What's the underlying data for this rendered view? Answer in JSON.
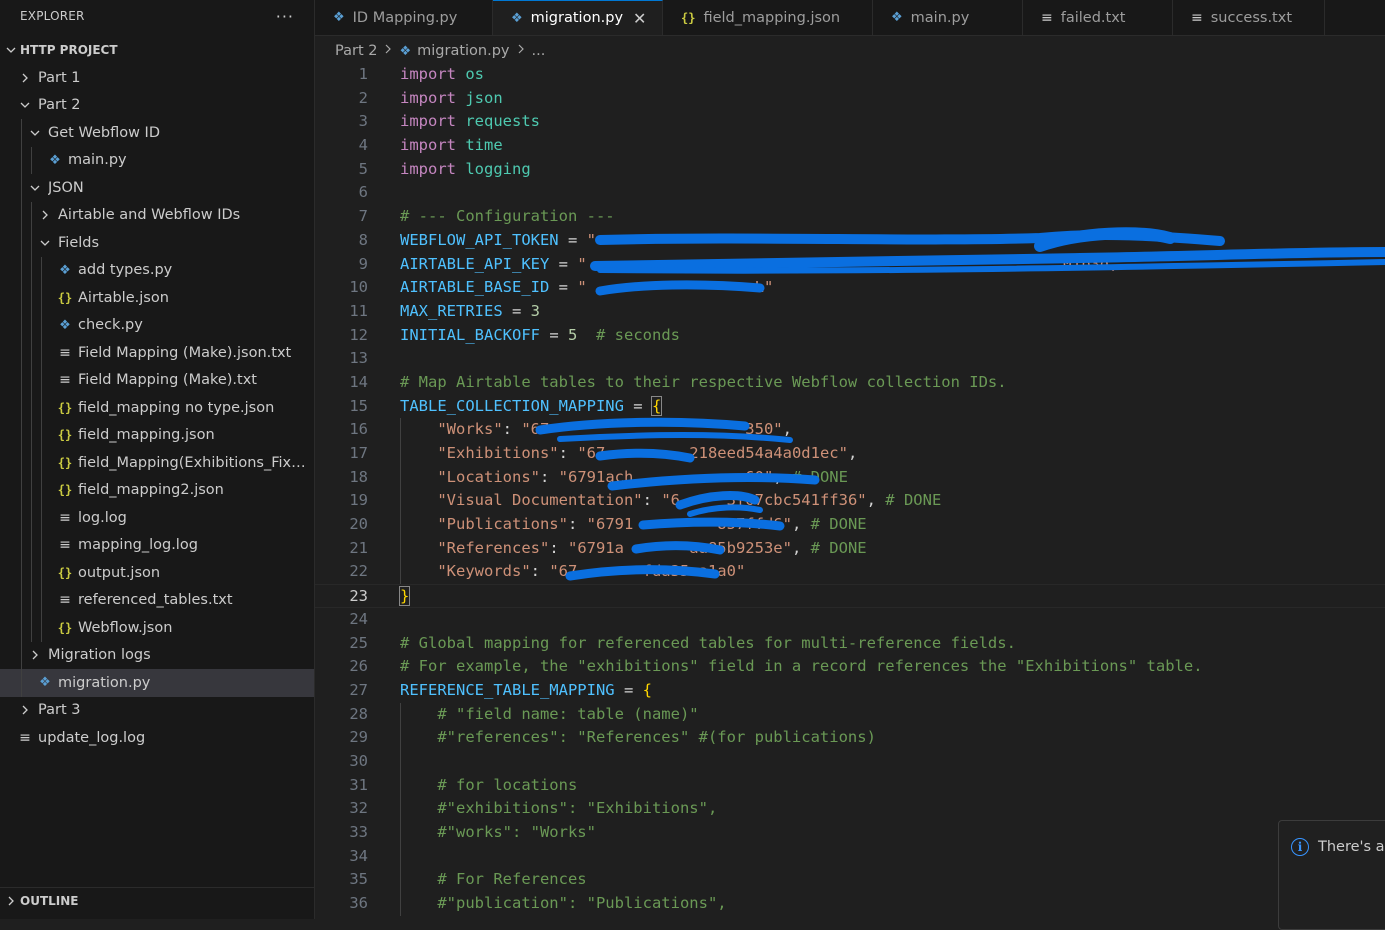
{
  "sidebar": {
    "title": "EXPLORER",
    "more": "···",
    "project": "HTTP PROJECT",
    "outline": "OUTLINE",
    "items": [
      {
        "label": "Part 1",
        "type": "folder",
        "level": 0,
        "open": false
      },
      {
        "label": "Part 2",
        "type": "folder",
        "level": 0,
        "open": true
      },
      {
        "label": "Get Webflow ID",
        "type": "folder",
        "level": 1,
        "open": true
      },
      {
        "label": "main.py",
        "type": "py",
        "level": 2
      },
      {
        "label": "JSON",
        "type": "folder",
        "level": 1,
        "open": true
      },
      {
        "label": "Airtable and Webflow IDs",
        "type": "folder",
        "level": 2,
        "open": false
      },
      {
        "label": "Fields",
        "type": "folder",
        "level": 2,
        "open": true
      },
      {
        "label": "add types.py",
        "type": "py",
        "level": 3
      },
      {
        "label": "Airtable.json",
        "type": "json",
        "level": 3
      },
      {
        "label": "check.py",
        "type": "py",
        "level": 3
      },
      {
        "label": "Field Mapping (Make).json.txt",
        "type": "txt",
        "level": 3
      },
      {
        "label": "Field Mapping (Make).txt",
        "type": "txt",
        "level": 3
      },
      {
        "label": "field_mapping no type.json",
        "type": "json",
        "level": 3
      },
      {
        "label": "field_mapping.json",
        "type": "json",
        "level": 3
      },
      {
        "label": "field_Mapping(Exhibitions_Fix).js...",
        "type": "json",
        "level": 3
      },
      {
        "label": "field_mapping2.json",
        "type": "json",
        "level": 3
      },
      {
        "label": "log.log",
        "type": "txt",
        "level": 3
      },
      {
        "label": "mapping_log.log",
        "type": "txt",
        "level": 3
      },
      {
        "label": "output.json",
        "type": "json",
        "level": 3
      },
      {
        "label": "referenced_tables.txt",
        "type": "txt",
        "level": 3
      },
      {
        "label": "Webflow.json",
        "type": "json",
        "level": 3
      },
      {
        "label": "Migration logs",
        "type": "folder",
        "level": 1,
        "open": false
      },
      {
        "label": "migration.py",
        "type": "py",
        "level": 1,
        "selected": true
      },
      {
        "label": "Part 3",
        "type": "folder",
        "level": 0,
        "open": false
      },
      {
        "label": "update_log.log",
        "type": "txt",
        "level": 0
      }
    ]
  },
  "tabs": [
    {
      "label": "ID Mapping.py",
      "type": "py",
      "width": 178
    },
    {
      "label": "migration.py",
      "type": "py",
      "active": true,
      "close": "✕",
      "width": 170
    },
    {
      "label": "field_mapping.json",
      "type": "json",
      "width": 210
    },
    {
      "label": "main.py",
      "type": "py",
      "width": 150
    },
    {
      "label": "failed.txt",
      "type": "txt",
      "width": 150
    },
    {
      "label": "success.txt",
      "type": "txt",
      "width": 152
    }
  ],
  "breadcrumb": {
    "folder": "Part 2",
    "file": "migration.py",
    "rest": "..."
  },
  "editor": {
    "current_line": 23,
    "lines": [
      [
        [
          "kw",
          "import"
        ],
        [
          "op",
          " "
        ],
        [
          "mod",
          "os"
        ]
      ],
      [
        [
          "kw",
          "import"
        ],
        [
          "op",
          " "
        ],
        [
          "mod",
          "json"
        ]
      ],
      [
        [
          "kw",
          "import"
        ],
        [
          "op",
          " "
        ],
        [
          "mod",
          "requests"
        ]
      ],
      [
        [
          "kw",
          "import"
        ],
        [
          "op",
          " "
        ],
        [
          "mod",
          "time"
        ]
      ],
      [
        [
          "kw",
          "import"
        ],
        [
          "op",
          " "
        ],
        [
          "mod",
          "logging"
        ]
      ],
      [],
      [
        [
          "cmt",
          "# --- Configuration ---"
        ]
      ],
      [
        [
          "var",
          "WEBFLOW_API_TOKEN"
        ],
        [
          "op",
          " = "
        ],
        [
          "str",
          "\"                                                               \""
        ]
      ],
      [
        [
          "var",
          "AIRTABLE_API_KEY"
        ],
        [
          "op",
          " = "
        ],
        [
          "str",
          "\"                                                   01b3d,"
        ]
      ],
      [
        [
          "var",
          "AIRTABLE_BASE_ID"
        ],
        [
          "op",
          " = "
        ],
        [
          "str",
          "\"                  L\""
        ]
      ],
      [
        [
          "var",
          "MAX_RETRIES"
        ],
        [
          "op",
          " = "
        ],
        [
          "num",
          "3"
        ]
      ],
      [
        [
          "var",
          "INITIAL_BACKOFF"
        ],
        [
          "op",
          " = "
        ],
        [
          "num",
          "5"
        ],
        [
          "op",
          "  "
        ],
        [
          "cmt",
          "# seconds"
        ]
      ],
      [],
      [
        [
          "cmt",
          "# Map Airtable tables to their respective Webflow collection IDs."
        ]
      ],
      [
        [
          "var",
          "TABLE_COLLECTION_MAPPING"
        ],
        [
          "op",
          " = "
        ],
        [
          "br",
          "{"
        ]
      ],
      [
        [
          "op",
          "    "
        ],
        [
          "str",
          "\"Works\""
        ],
        [
          "op",
          ": "
        ],
        [
          "str",
          "\"67                     350\""
        ],
        [
          "op",
          ","
        ]
      ],
      [
        [
          "op",
          "    "
        ],
        [
          "str",
          "\"Exhibitions\""
        ],
        [
          "op",
          ": "
        ],
        [
          "str",
          "\"67         218eed54a4a0d1ec\""
        ],
        [
          "op",
          ","
        ]
      ],
      [
        [
          "op",
          "    "
        ],
        [
          "str",
          "\"Locations\""
        ],
        [
          "op",
          ": "
        ],
        [
          "str",
          "\"6791ach            60\""
        ],
        [
          "op",
          ", "
        ],
        [
          "cmt",
          "# DONE"
        ]
      ],
      [
        [
          "op",
          "    "
        ],
        [
          "str",
          "\"Visual Documentation\""
        ],
        [
          "op",
          ": "
        ],
        [
          "str",
          "\"6     3f67cbc541ff36\""
        ],
        [
          "op",
          ", "
        ],
        [
          "cmt",
          "# DONE"
        ]
      ],
      [
        [
          "op",
          "    "
        ],
        [
          "str",
          "\"Publications\""
        ],
        [
          "op",
          ": "
        ],
        [
          "str",
          "\"6791         857ffd6\""
        ],
        [
          "op",
          ", "
        ],
        [
          "cmt",
          "# DONE"
        ]
      ],
      [
        [
          "op",
          "    "
        ],
        [
          "str",
          "\"References\""
        ],
        [
          "op",
          ": "
        ],
        [
          "str",
          "\"6791a       aa85b9253e\""
        ],
        [
          "op",
          ", "
        ],
        [
          "cmt",
          "# DONE"
        ]
      ],
      [
        [
          "op",
          "    "
        ],
        [
          "str",
          "\"Keywords\""
        ],
        [
          "op",
          ": "
        ],
        [
          "str",
          "\"67       fda35ca1a0\""
        ]
      ],
      [
        [
          "br",
          "}"
        ]
      ],
      [],
      [
        [
          "cmt",
          "# Global mapping for referenced tables for multi-reference fields."
        ]
      ],
      [
        [
          "cmt",
          "# For example, the \"exhibitions\" field in a record references the \"Exhibitions\" table."
        ]
      ],
      [
        [
          "var",
          "REFERENCE_TABLE_MAPPING"
        ],
        [
          "op",
          " = "
        ],
        [
          "br",
          "{"
        ]
      ],
      [
        [
          "op",
          "    "
        ],
        [
          "cmt",
          "# \"field name: table (name)\""
        ]
      ],
      [
        [
          "op",
          "    "
        ],
        [
          "cmt",
          "#\"references\": \"References\" #(for publications)"
        ]
      ],
      [],
      [
        [
          "op",
          "    "
        ],
        [
          "cmt",
          "# for locations"
        ]
      ],
      [
        [
          "op",
          "    "
        ],
        [
          "cmt",
          "#\"exhibitions\": \"Exhibitions\","
        ]
      ],
      [
        [
          "op",
          "    "
        ],
        [
          "cmt",
          "#\"works\": \"Works\""
        ]
      ],
      [],
      [
        [
          "op",
          "    "
        ],
        [
          "cmt",
          "# For References"
        ]
      ],
      [
        [
          "op",
          "    "
        ],
        [
          "cmt",
          "#\"publication\": \"Publications\","
        ]
      ]
    ]
  },
  "notification": {
    "text": "There's ar"
  },
  "colors": {
    "background": "#1f1f1f",
    "sidebar": "#181818",
    "selected": "#37373d",
    "keyword": "#c586c0",
    "module": "#4ec9b0",
    "variable": "#4fc1ff",
    "string": "#ce9178",
    "comment": "#6a9955",
    "number": "#b5cea8",
    "redaction": "#0a6fe0"
  }
}
